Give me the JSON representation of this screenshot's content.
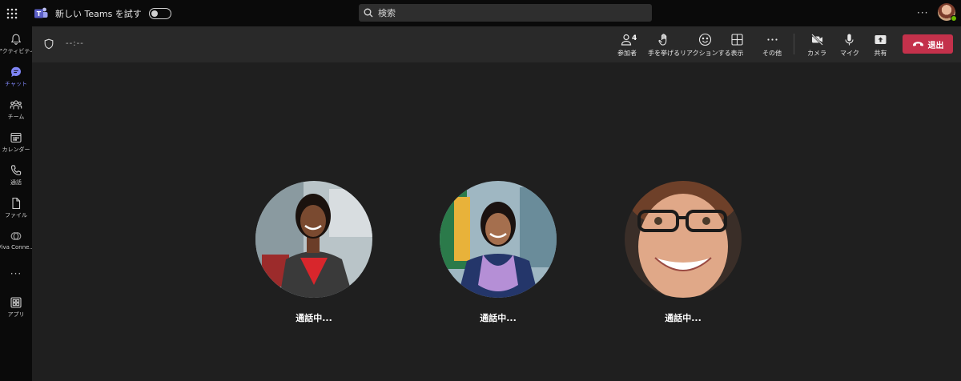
{
  "titlebar": {
    "try_new_teams": "新しい Teams を試す",
    "search_placeholder": "検索",
    "more": "···"
  },
  "rail": {
    "items": [
      {
        "label": "アクティビティ",
        "icon": "bell-icon"
      },
      {
        "label": "チャット",
        "icon": "chat-icon",
        "active": true
      },
      {
        "label": "チーム",
        "icon": "teams-icon"
      },
      {
        "label": "カレンダー",
        "icon": "calendar-icon"
      },
      {
        "label": "通話",
        "icon": "phone-icon"
      },
      {
        "label": "ファイル",
        "icon": "file-icon"
      },
      {
        "label": "Viva Conne...",
        "icon": "viva-connections-icon"
      },
      {
        "label": "アプリ",
        "icon": "apps-icon"
      }
    ],
    "more": "···"
  },
  "meeting": {
    "timer": "--:--",
    "participants_count": "4",
    "tools": {
      "participants": "参加者",
      "raise_hand": "手を挙げる",
      "react": "リアクションする",
      "view": "表示",
      "more": "その他",
      "camera": "カメラ",
      "mic": "マイク",
      "share": "共有"
    },
    "leave": "退出",
    "colors": {
      "leave": "#c4314b",
      "accent": "#7f85f5",
      "toolbar": "#292929",
      "stage": "#1f1f1f"
    }
  },
  "participants": [
    {
      "status": "通話中..."
    },
    {
      "status": "通話中..."
    },
    {
      "status": "通話中..."
    }
  ]
}
